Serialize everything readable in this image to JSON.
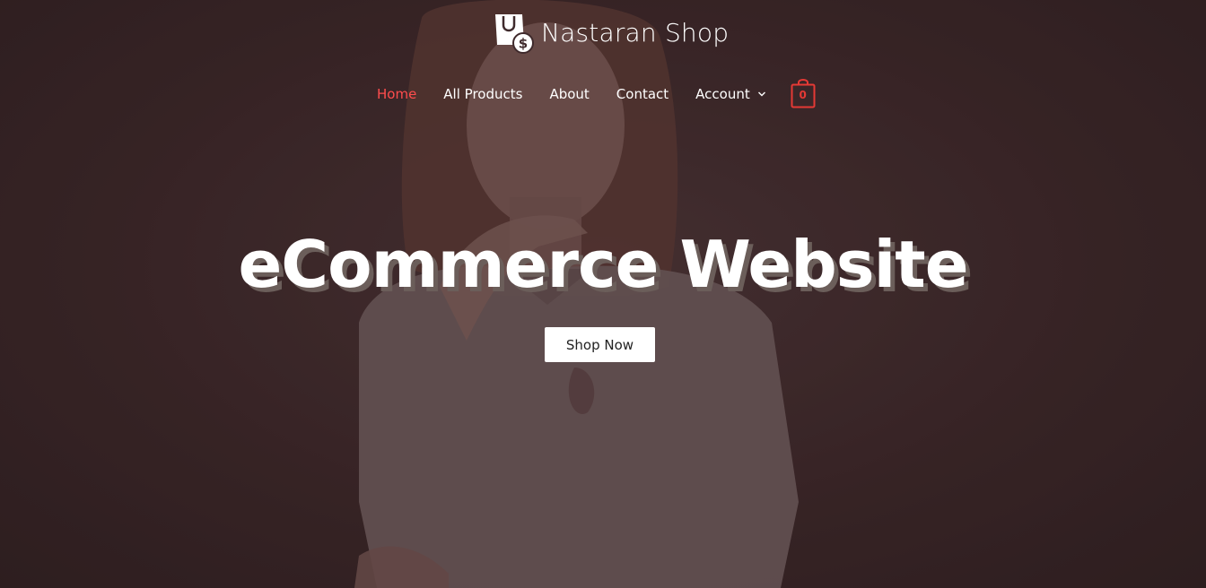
{
  "brand": {
    "name": "Nastaran Shop",
    "logo_icon": "shopping-bag-dollar-icon"
  },
  "nav": {
    "items": [
      {
        "label": "Home",
        "active": true
      },
      {
        "label": "All Products",
        "active": false
      },
      {
        "label": "About",
        "active": false
      },
      {
        "label": "Contact",
        "active": false
      },
      {
        "label": "Account",
        "active": false,
        "has_dropdown": true
      }
    ]
  },
  "cart": {
    "icon": "shopping-bag-icon",
    "count": "0"
  },
  "hero": {
    "title": "eCommerce Website",
    "cta_label": "Shop Now"
  },
  "colors": {
    "accent": "#ff4d4d",
    "cart": "#e53935",
    "background": "#3f2a2c",
    "text": "#ffffff"
  }
}
